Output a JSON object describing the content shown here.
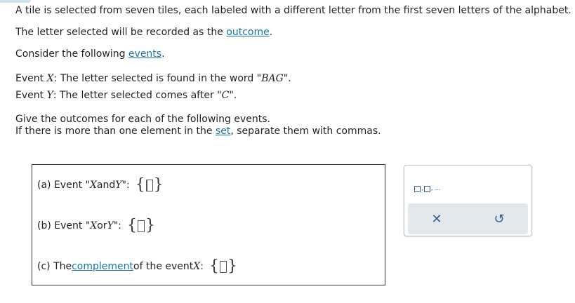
{
  "problem": {
    "line1": "A tile is selected from seven tiles, each labeled with a different letter from the first seven letters of the alphabet.",
    "line2_prefix": "The letter selected will be recorded as the ",
    "line2_link": "outcome",
    "line2_suffix": ".",
    "line3_prefix": "Consider the following ",
    "line3_link": "events",
    "line3_suffix": ".",
    "eventX_prefix": "Event ",
    "eventX_var": "X",
    "eventX_mid": ": The letter selected is found in the word \"",
    "eventX_word": "BAG",
    "eventX_end": "\".",
    "eventY_prefix": "Event ",
    "eventY_var": "Y",
    "eventY_mid": ": The letter selected comes after \"",
    "eventY_letter": "C",
    "eventY_end": "\".",
    "instr1": "Give the outcomes for each of the following events.",
    "instr2_prefix": "If there is more than one element in the ",
    "instr2_link": "set",
    "instr2_suffix": ", separate them with commas."
  },
  "answers": {
    "a": {
      "label": "(a) Event \"",
      "var1": "X",
      "mid": " and ",
      "var2": "Y",
      "end": "\":"
    },
    "b": {
      "label": "(b) Event \"",
      "var1": "X",
      "mid": " or ",
      "var2": "Y",
      "end": "\":"
    },
    "c": {
      "label": "(c) The ",
      "link": "complement",
      "mid": " of the event ",
      "var1": "X",
      "end": ":"
    },
    "brace_open": "{",
    "brace_close": "}"
  },
  "toolbox": {
    "set_button_sep": ",",
    "set_button_ellipsis": "...",
    "clear_symbol": "✕",
    "undo_symbol": "↺",
    "accent_color": "#2f5f8a"
  }
}
